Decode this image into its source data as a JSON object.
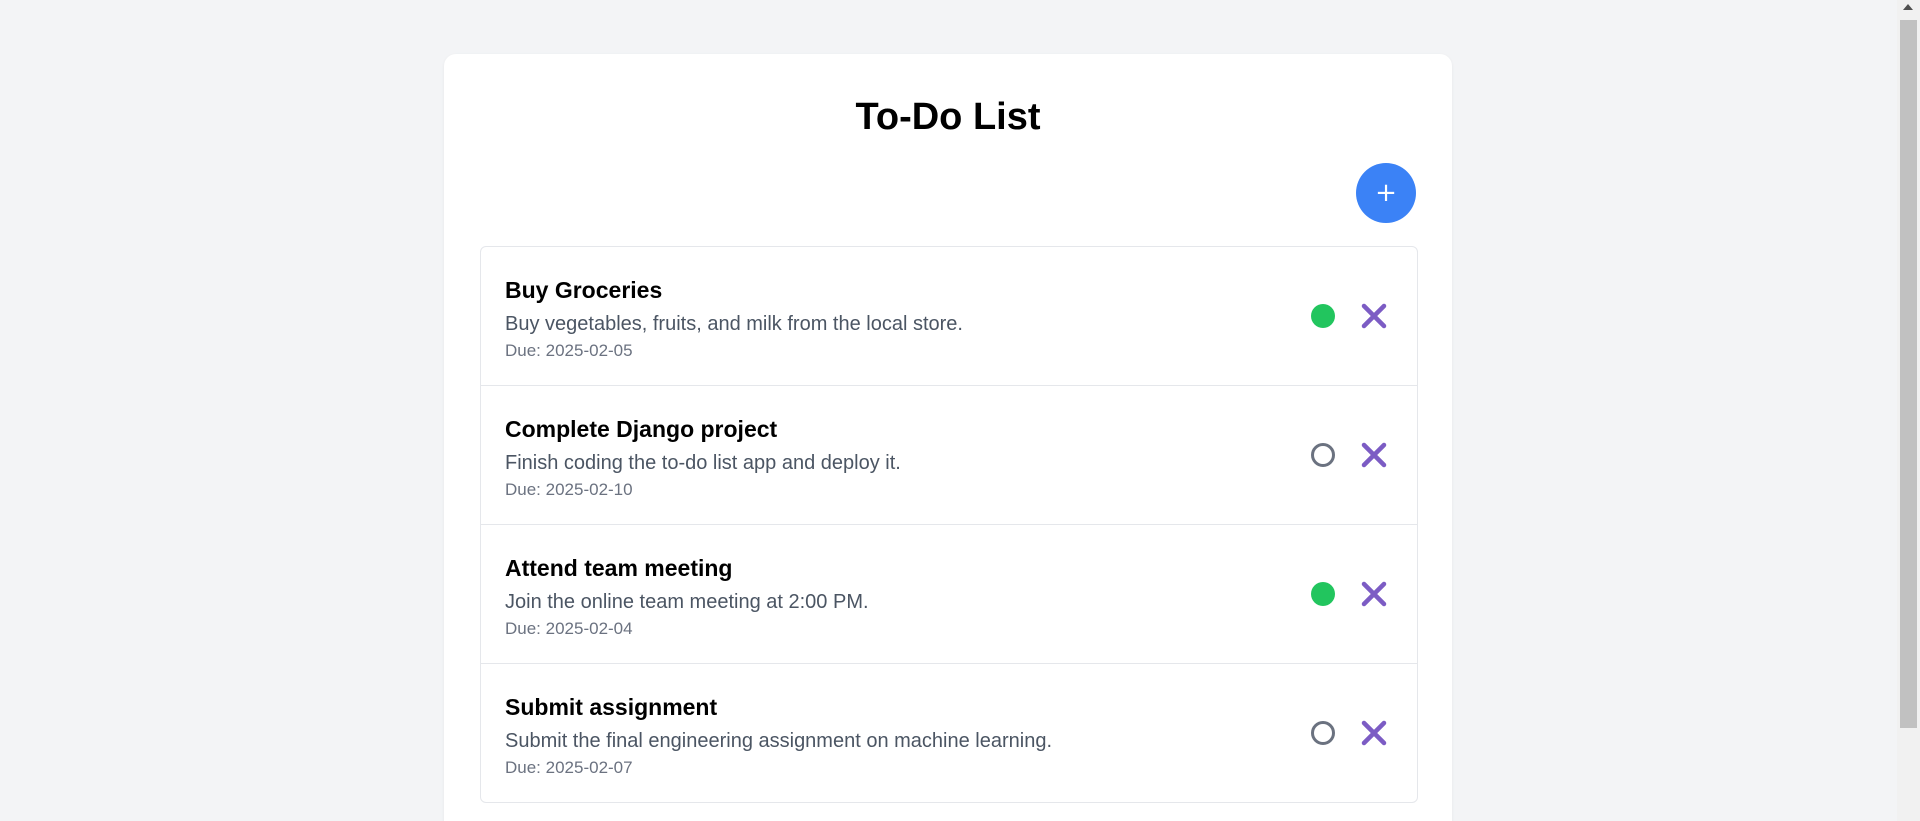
{
  "page": {
    "title": "To-Do List",
    "add_button_label": "+"
  },
  "colors": {
    "background": "#f3f4f6",
    "card": "#ffffff",
    "add_button": "#3b82f6",
    "status_done": "#22c55e",
    "status_open_border": "#6b7280",
    "delete_icon": "#7c5cc4"
  },
  "tasks": [
    {
      "title": "Buy Groceries",
      "description": "Buy vegetables, fruits, and milk from the local store.",
      "due": "Due: 2025-02-05",
      "completed": true
    },
    {
      "title": "Complete Django project",
      "description": "Finish coding the to-do list app and deploy it.",
      "due": "Due: 2025-02-10",
      "completed": false
    },
    {
      "title": "Attend team meeting",
      "description": "Join the online team meeting at 2:00 PM.",
      "due": "Due: 2025-02-04",
      "completed": true
    },
    {
      "title": "Submit assignment",
      "description": "Submit the final engineering assignment on machine learning.",
      "due": "Due: 2025-02-07",
      "completed": false
    }
  ],
  "icons": {
    "add": "plus-icon",
    "status_done": "filled-circle-icon",
    "status_open": "empty-circle-icon",
    "delete": "close-icon"
  }
}
